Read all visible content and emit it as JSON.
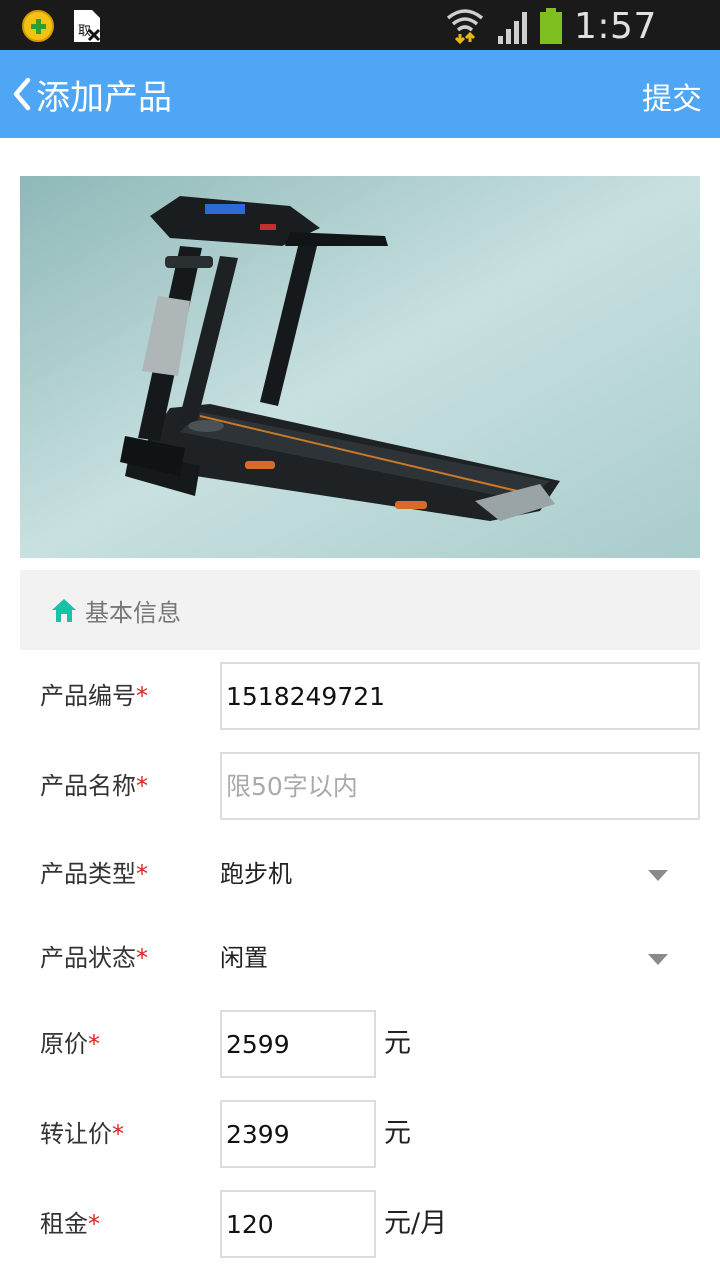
{
  "status_bar": {
    "time": "1:57 PM",
    "icons": [
      "app-notification-icon",
      "sim-card-icon",
      "wifi-icon",
      "cell-signal-icon",
      "battery-icon"
    ]
  },
  "header": {
    "title": "添加产品",
    "submit_label": "提交",
    "background_color": "#4ea6f5"
  },
  "section": {
    "title": "基本信息",
    "icon": "home-icon",
    "icon_color": "#19c2a6"
  },
  "form": {
    "product_code": {
      "label": "产品编号",
      "required": "*",
      "value": "1518249721"
    },
    "product_name": {
      "label": "产品名称",
      "required": "*",
      "value": "",
      "placeholder": "限50字以内"
    },
    "product_type": {
      "label": "产品类型",
      "required": "*",
      "value": "跑步机"
    },
    "product_status": {
      "label": "产品状态",
      "required": "*",
      "value": "闲置"
    },
    "original_price": {
      "label": "原价",
      "required": "*",
      "value": "2599",
      "unit": "元"
    },
    "transfer_price": {
      "label": "转让价",
      "required": "*",
      "value": "2399",
      "unit": "元"
    },
    "rent": {
      "label": "租金",
      "required": "*",
      "value": "120",
      "unit": "元/月"
    }
  }
}
